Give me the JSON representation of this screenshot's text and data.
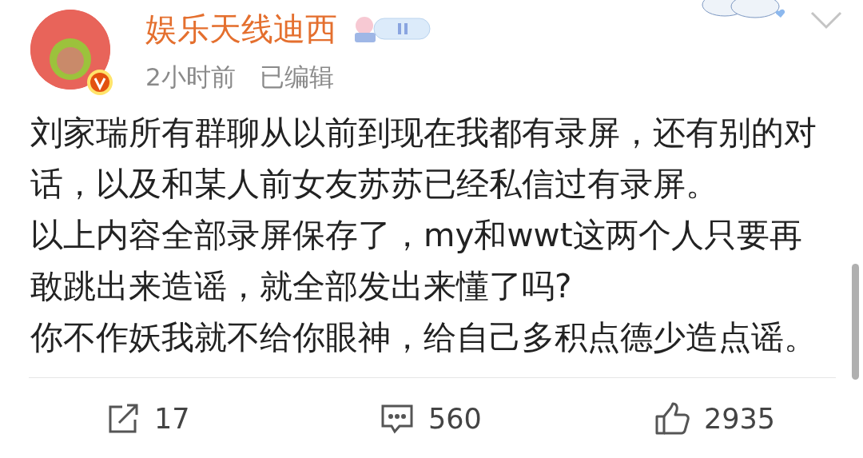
{
  "author": {
    "name": "娱乐天线迪西",
    "verified": true
  },
  "meta": {
    "time": "2小时前",
    "edited": "已编辑"
  },
  "paragraphs": [
    "刘家瑞所有群聊从以前到现在我都有录屏，还有别的对话，以及和某人前女友苏苏已经私信过有录屏。",
    "以上内容全部录屏保存了，my和wwt这两个人只要再敢跳出来造谣，就全部发出来懂了吗?",
    "你不作妖我就不给你眼神，给自己多积点德少造点谣。"
  ],
  "actions": [
    {
      "kind": "share",
      "count": "17"
    },
    {
      "kind": "comment",
      "count": "560"
    },
    {
      "kind": "like",
      "count": "2935"
    }
  ]
}
